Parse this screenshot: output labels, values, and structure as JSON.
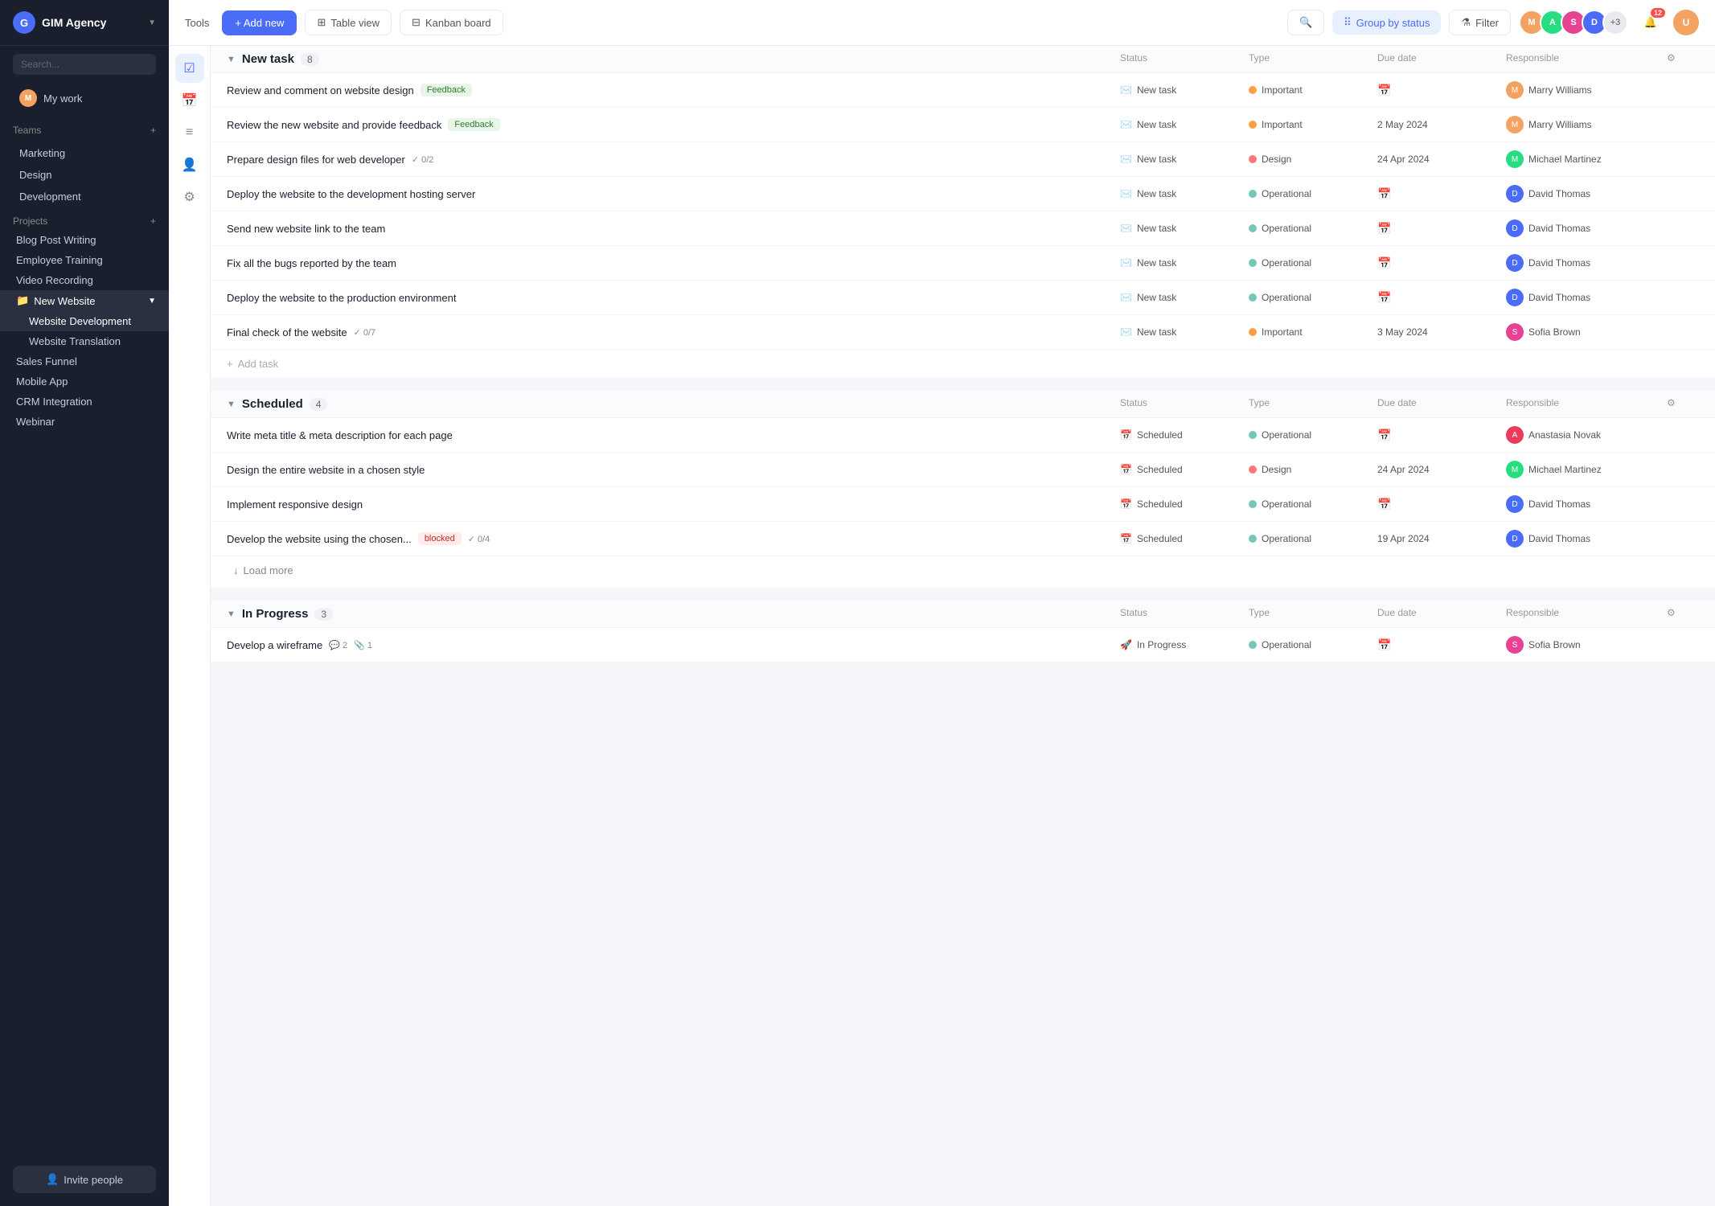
{
  "app": {
    "name": "GIM Agency",
    "logo_text": "G"
  },
  "sidebar": {
    "search_placeholder": "Search...",
    "my_work": "My work",
    "teams_label": "Teams",
    "teams": [
      {
        "id": "marketing",
        "label": "Marketing"
      },
      {
        "id": "design",
        "label": "Design"
      },
      {
        "id": "development",
        "label": "Development"
      }
    ],
    "projects_label": "Projects",
    "projects": [
      {
        "id": "blog-post",
        "label": "Blog Post Writing",
        "active": false
      },
      {
        "id": "employee-training",
        "label": "Employee Training",
        "active": false
      },
      {
        "id": "video-recording",
        "label": "Video Recording",
        "active": false
      },
      {
        "id": "new-website",
        "label": "New Website",
        "active": true,
        "children": [
          {
            "id": "website-development",
            "label": "Website Development",
            "active": true
          },
          {
            "id": "website-translation",
            "label": "Website Translation",
            "active": false
          }
        ]
      },
      {
        "id": "sales-funnel",
        "label": "Sales Funnel",
        "active": false
      },
      {
        "id": "mobile-app",
        "label": "Mobile App",
        "active": false
      },
      {
        "id": "crm-integration",
        "label": "CRM Integration",
        "active": false
      },
      {
        "id": "webinar",
        "label": "Webinar",
        "active": false
      }
    ],
    "invite_btn": "Invite people"
  },
  "toolbar": {
    "tools_label": "Tools",
    "add_new": "+ Add new",
    "table_view": "Table view",
    "kanban_board": "Kanban board",
    "group_by_status": "Group by status",
    "filter": "Filter",
    "notif_count": "12",
    "extra_avatars": "+3"
  },
  "columns": {
    "status": "Status",
    "type": "Type",
    "due_date": "Due date",
    "responsible": "Responsible"
  },
  "sections": [
    {
      "id": "new-task",
      "title": "New task",
      "count": 8,
      "tasks": [
        {
          "id": 1,
          "name": "Review and comment on website design",
          "tag": "Feedback",
          "tag_class": "tag-feedback",
          "status": "New task",
          "status_icon": "✉️",
          "type": "Important",
          "type_dot": "dot-important",
          "due_date": "",
          "responsible": "Marry Williams",
          "resp_color": "av-orange"
        },
        {
          "id": 2,
          "name": "Review the new website and provide feedback",
          "tag": "Feedback",
          "tag_class": "tag-feedback",
          "status": "New task",
          "status_icon": "✉️",
          "type": "Important",
          "type_dot": "dot-important",
          "due_date": "2 May 2024",
          "responsible": "Marry Williams",
          "resp_color": "av-orange"
        },
        {
          "id": 3,
          "name": "Prepare design files for web developer",
          "subtask": "✓ 0/2",
          "status": "New task",
          "status_icon": "✉️",
          "type": "Design",
          "type_dot": "dot-design",
          "due_date": "24 Apr 2024",
          "responsible": "Michael Martinez",
          "resp_color": "av-teal"
        },
        {
          "id": 4,
          "name": "Deploy the website to the development hosting server",
          "status": "New task",
          "status_icon": "✉️",
          "type": "Operational",
          "type_dot": "dot-operational",
          "due_date": "",
          "responsible": "David Thomas",
          "resp_color": "av-blue"
        },
        {
          "id": 5,
          "name": "Send new website link to the team",
          "status": "New task",
          "status_icon": "✉️",
          "type": "Operational",
          "type_dot": "dot-operational",
          "due_date": "",
          "responsible": "David Thomas",
          "resp_color": "av-blue"
        },
        {
          "id": 6,
          "name": "Fix all the bugs reported by the team",
          "status": "New task",
          "status_icon": "✉️",
          "type": "Operational",
          "type_dot": "dot-operational",
          "due_date": "",
          "responsible": "David Thomas",
          "resp_color": "av-blue"
        },
        {
          "id": 7,
          "name": "Deploy the website to the production environment",
          "status": "New task",
          "status_icon": "✉️",
          "type": "Operational",
          "type_dot": "dot-operational",
          "due_date": "",
          "responsible": "David Thomas",
          "resp_color": "av-blue"
        },
        {
          "id": 8,
          "name": "Final check of the website",
          "subtask": "✓ 0/7",
          "status": "New task",
          "status_icon": "✉️",
          "type": "Important",
          "type_dot": "dot-important",
          "due_date": "3 May 2024",
          "responsible": "Sofia Brown",
          "resp_color": "av-pink"
        }
      ],
      "add_task": "+ Add task"
    },
    {
      "id": "scheduled",
      "title": "Scheduled",
      "count": 4,
      "tasks": [
        {
          "id": 9,
          "name": "Write meta title & meta description for each page",
          "status": "Scheduled",
          "status_icon": "📅",
          "type": "Operational",
          "type_dot": "dot-operational",
          "due_date": "",
          "responsible": "Anastasia Novak",
          "resp_color": "av-red"
        },
        {
          "id": 10,
          "name": "Design the entire website in a chosen style",
          "status": "Scheduled",
          "status_icon": "📅",
          "type": "Design",
          "type_dot": "dot-design",
          "due_date": "24 Apr 2024",
          "responsible": "Michael Martinez",
          "resp_color": "av-teal"
        },
        {
          "id": 11,
          "name": "Implement responsive design",
          "status": "Scheduled",
          "status_icon": "📅",
          "type": "Operational",
          "type_dot": "dot-operational",
          "due_date": "",
          "responsible": "David Thomas",
          "resp_color": "av-blue"
        },
        {
          "id": 12,
          "name": "Develop the website using the chosen...",
          "tag": "blocked",
          "tag_class": "tag-blocked",
          "subtask": "✓ 0/4",
          "status": "Scheduled",
          "status_icon": "📅",
          "type": "Operational",
          "type_dot": "dot-operational",
          "due_date": "19 Apr 2024",
          "responsible": "David Thomas",
          "resp_color": "av-blue"
        }
      ],
      "load_more": "↓ Load more"
    },
    {
      "id": "in-progress",
      "title": "In Progress",
      "count": 3,
      "tasks": [
        {
          "id": 13,
          "name": "Develop a wireframe",
          "comments": "💬 2",
          "attachments": "📎 1",
          "status": "In Progress",
          "status_icon": "🚀",
          "type": "Operational",
          "type_dot": "dot-operational",
          "due_date": "",
          "responsible": "Sofia Brown",
          "resp_color": "av-pink"
        }
      ]
    }
  ]
}
